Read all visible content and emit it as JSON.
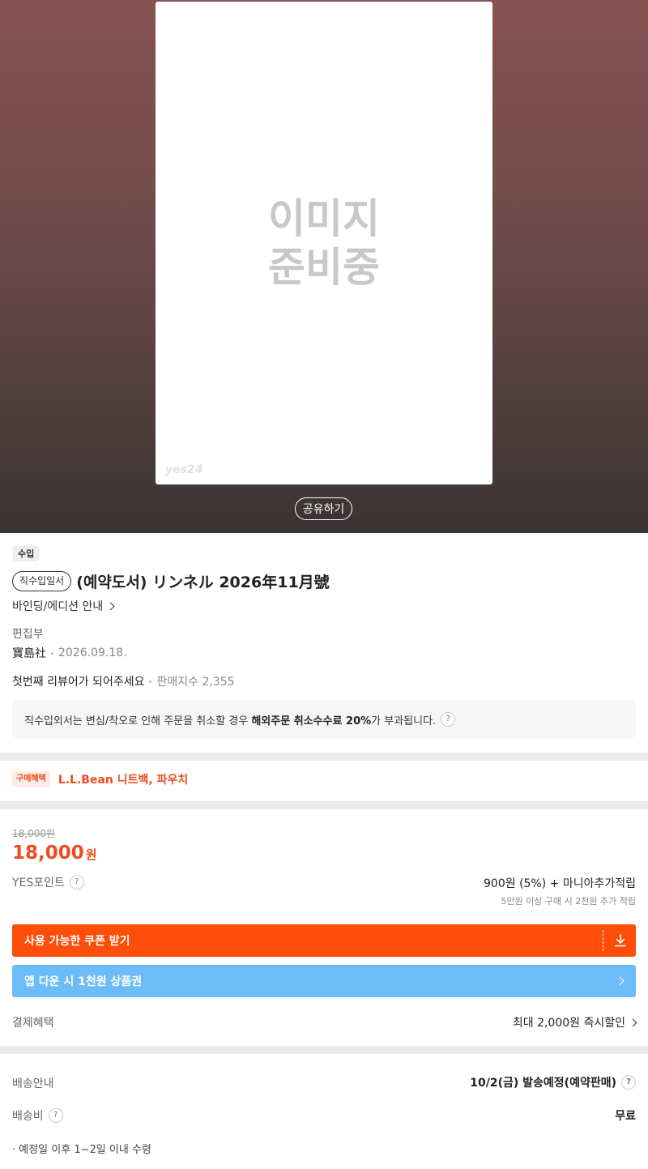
{
  "cover": {
    "placeholder_line1": "이미지",
    "placeholder_line2": "준비중",
    "logo": "yes24",
    "share_label": "공유하기"
  },
  "product": {
    "type_tag": "수입",
    "category_pill": "직수입일서",
    "title": "(예약도서) リンネル 2026年11月號",
    "binding_link": "바인딩/에디션 안내",
    "author": "편집부",
    "publisher": "寶島社",
    "pub_date": "2026.09.18.",
    "review_prompt": "첫번째 리뷰어가 되어주세요",
    "sales_index": "판매지수 2,355"
  },
  "notice": {
    "text_before": "직수입외서는 변심/착오로 인해 주문을 취소할 경우 ",
    "text_bold": "해외주문 취소수수료 20%",
    "text_after": "가 부과됩니다.",
    "help": "?"
  },
  "benefit": {
    "tag": "구매혜택",
    "text": "L.L.Bean 니트백, 파우치"
  },
  "price": {
    "original": "18,000원",
    "sale": "18,000",
    "unit": "원",
    "points_label": "YES포인트",
    "points_help": "?",
    "points_value": "900원 (5%) + 마니아추가적립",
    "points_sub": "5만원 이상 구매 시 2천원 추가 적립"
  },
  "coupon": {
    "label": "사용 가능한 쿠폰 받기",
    "icon": "download-icon"
  },
  "app_promo": {
    "label": "앱 다운 시 1천원 상품권",
    "icon": "chevron-right-icon"
  },
  "payment": {
    "label": "결제혜택",
    "value": "최대 2,000원 즉시할인"
  },
  "shipping": {
    "label": "배송안내",
    "value": "10/2(금) 발송예정(예약판매)",
    "help": "?",
    "fee_label": "배송비",
    "fee_help": "?",
    "fee_value": "무료",
    "receive_note": "· 예정일 이후 1~2일 이내 수령"
  },
  "colors": {
    "accent": "#ff4d0a",
    "sale": "#ef4b1f",
    "app_button": "#6cbcf8"
  }
}
